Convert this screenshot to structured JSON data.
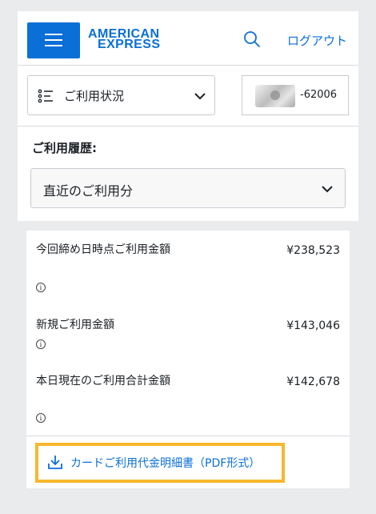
{
  "header": {
    "logo_line1": "AMERICAN",
    "logo_line2": "EXPRESS",
    "logout_label": "ログアウト",
    "brand_color": "#0a6fd6"
  },
  "status_dropdown": {
    "label": "ご利用状況",
    "icon": "list-icon"
  },
  "card_selector": {
    "card_number": "-62006"
  },
  "history": {
    "label": "ご利用履歴:",
    "period_selected": "直近のご利用分"
  },
  "summary": {
    "rows": [
      {
        "label": "今回締め日時点ご利用金額",
        "value": "¥238,523"
      },
      {
        "label": "新規ご利用金額",
        "value": "¥143,046"
      },
      {
        "label": "本日現在のご利用合計金額",
        "value": "¥142,678"
      }
    ],
    "info_symbol": "i",
    "pdf_link_label": "カードご利用代金明細書（PDF形式）",
    "highlight_color": "#f7b82f"
  }
}
